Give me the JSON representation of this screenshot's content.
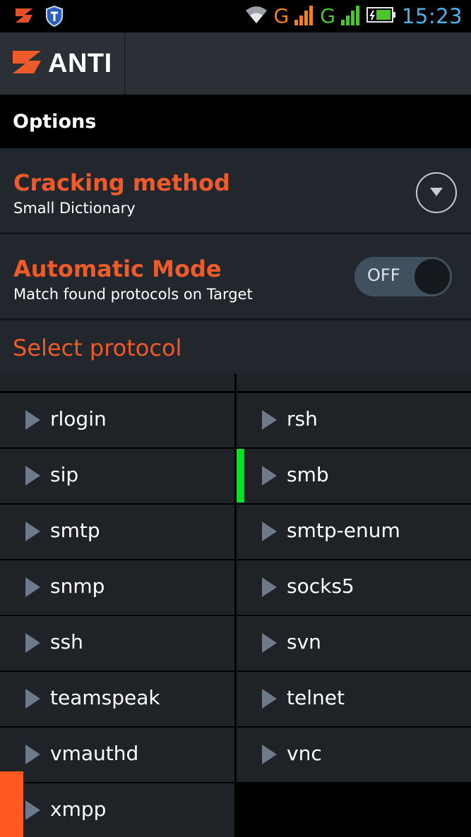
{
  "status_bar": {
    "network1": "G",
    "network2": "G",
    "time": "15:23",
    "colors": {
      "network1": "#f0821e",
      "network2": "#4cc62e",
      "time": "#4ab4e8"
    }
  },
  "app": {
    "title": "ANTI",
    "accent": "#ee5a2a"
  },
  "options": {
    "title": "Options"
  },
  "cracking_method": {
    "title": "Cracking method",
    "value": "Small Dictionary"
  },
  "automatic_mode": {
    "title": "Automatic Mode",
    "subtitle": "Match found protocols on Target",
    "toggle_label": "OFF",
    "enabled": false
  },
  "select_protocol": {
    "title": "Select protocol",
    "protocols": [
      {
        "name": "rlogin"
      },
      {
        "name": "rsh"
      },
      {
        "name": "sip"
      },
      {
        "name": "smb",
        "selected": true
      },
      {
        "name": "smtp"
      },
      {
        "name": "smtp-enum"
      },
      {
        "name": "snmp"
      },
      {
        "name": "socks5"
      },
      {
        "name": "ssh"
      },
      {
        "name": "svn"
      },
      {
        "name": "teamspeak"
      },
      {
        "name": "telnet"
      },
      {
        "name": "vmauthd"
      },
      {
        "name": "vnc"
      },
      {
        "name": "xmpp"
      }
    ]
  }
}
